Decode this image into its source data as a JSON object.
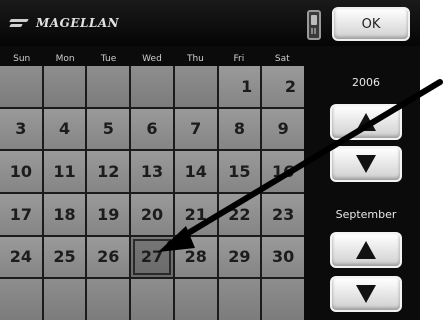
{
  "header": {
    "logo_text": "MAGELLAN",
    "ok_label": "OK",
    "device_icon": "gps-device-icon"
  },
  "day_names": [
    "Sun",
    "Mon",
    "Tue",
    "Wed",
    "Thu",
    "Fri",
    "Sat"
  ],
  "calendar": {
    "rows": [
      [
        "",
        "",
        "",
        "",
        "",
        "1",
        "2"
      ],
      [
        "3",
        "4",
        "5",
        "6",
        "7",
        "8",
        "9"
      ],
      [
        "10",
        "11",
        "12",
        "13",
        "14",
        "15",
        "16"
      ],
      [
        "17",
        "18",
        "19",
        "20",
        "21",
        "22",
        "23"
      ],
      [
        "24",
        "25",
        "26",
        "27",
        "28",
        "29",
        "30"
      ],
      [
        "",
        "",
        "",
        "",
        "",
        "",
        ""
      ]
    ],
    "selected_day": "27"
  },
  "side": {
    "year": "2006",
    "month": "September",
    "up_icon": "up-arrow-icon",
    "down_icon": "down-arrow-icon"
  }
}
